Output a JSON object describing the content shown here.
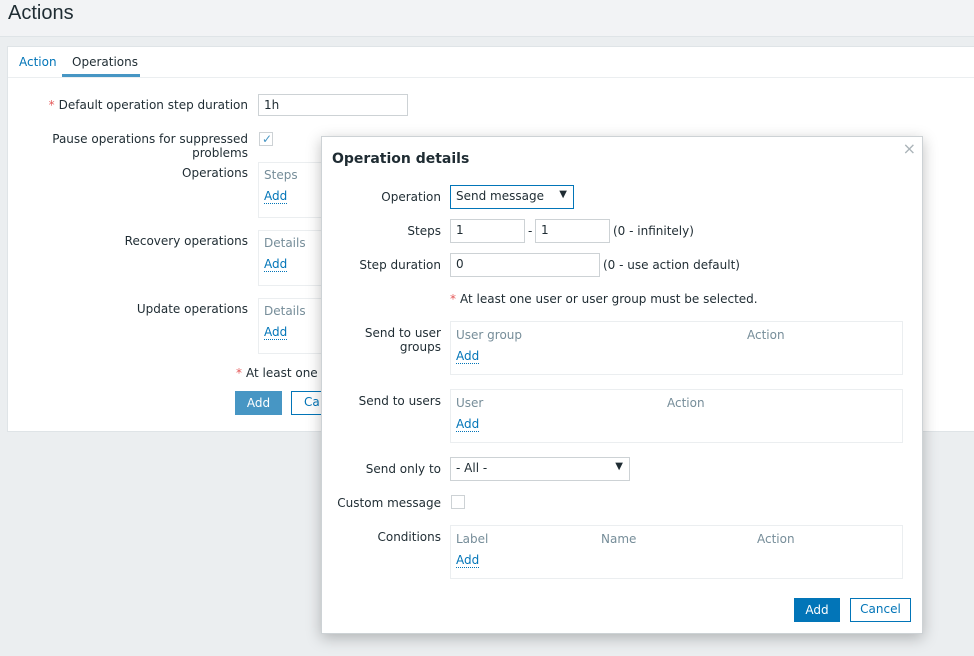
{
  "page": {
    "title": "Actions"
  },
  "tabs": [
    {
      "label": "Action"
    },
    {
      "label": "Operations"
    }
  ],
  "form": {
    "default_step_duration_label": "Default operation step duration",
    "default_step_duration_value": "1h",
    "pause_label": "Pause operations for suppressed problems",
    "pause_checked": true,
    "operations_label": "Operations",
    "operations_header": "Steps",
    "recovery_label": "Recovery operations",
    "recovery_header": "Details",
    "update_label": "Update operations",
    "update_header": "Details",
    "add_link": "Add",
    "warning": "At least one op",
    "add_button": "Add",
    "cancel_button": "Ca"
  },
  "dialog": {
    "title": "Operation details",
    "close": "×",
    "operation_label": "Operation",
    "operation_value": "Send message",
    "steps_label": "Steps",
    "steps_from": "1",
    "steps_dash": "-",
    "steps_to": "1",
    "steps_hint": "(0 - infinitely)",
    "step_duration_label": "Step duration",
    "step_duration_value": "0",
    "step_duration_hint": "(0 - use action default)",
    "warning": "At least one user or user group must be selected.",
    "user_groups_label": "Send to user groups",
    "user_groups_headers": [
      "User group",
      "Action"
    ],
    "users_label": "Send to users",
    "users_headers": [
      "User",
      "Action"
    ],
    "send_only_label": "Send only to",
    "send_only_value": "- All -",
    "custom_message_label": "Custom message",
    "conditions_label": "Conditions",
    "conditions_headers": [
      "Label",
      "Name",
      "Action"
    ],
    "add_link": "Add",
    "add_button": "Add",
    "cancel_button": "Cancel"
  },
  "colors": {
    "accent": "#0275b8",
    "required": "#e45959",
    "tab_active": "#4796c4"
  }
}
